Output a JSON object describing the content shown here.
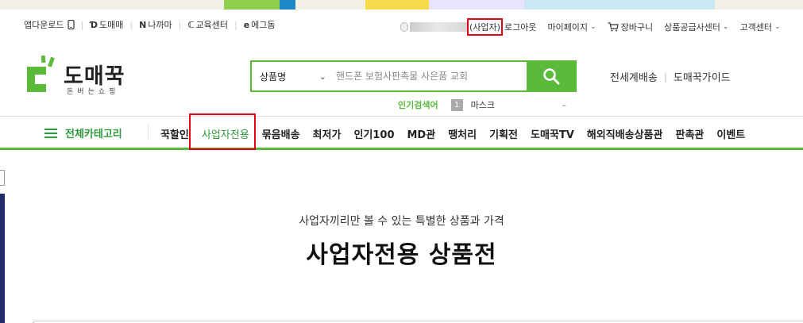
{
  "utility_bar": {
    "left_links": [
      {
        "label": "앱다운로드",
        "icon": "phone-icon"
      },
      {
        "label": "도매매",
        "icon": "domeme-logo-icon"
      },
      {
        "label": "나까마",
        "icon": "nakkama-logo-icon"
      },
      {
        "label": "교육센터",
        "icon": "edu-center-logo-icon"
      },
      {
        "label": "에그돔",
        "icon": "eggdome-logo-icon"
      }
    ],
    "user_grade": "(사업자)",
    "logout": "로그아웃",
    "mypage": "마이페이지",
    "cart": "장바구니",
    "supplier_center": "상품공급사센터",
    "customer_center": "고객센터"
  },
  "header": {
    "logo_text": "도매꾹",
    "logo_sub": "돈버는쇼핑",
    "search": {
      "category_selected": "상품명",
      "placeholder": "핸드폰 보험사판촉물 사은품 교회"
    },
    "links": [
      "전세계배송",
      "도매꾹가이드"
    ],
    "popular": {
      "label": "인기검색어",
      "rank": "1",
      "keyword": "마스크",
      "change": "–"
    }
  },
  "nav": {
    "all_category": "전체카테고리",
    "items": [
      "꾹할인",
      "사업자전용",
      "묶음배송",
      "최저가",
      "인기100",
      "MD관",
      "땡처리",
      "기획전",
      "도매꾹TV",
      "해외직배송상품관",
      "판촉관",
      "이벤트"
    ],
    "active_index": 1
  },
  "main": {
    "subtitle": "사업자끼리만 볼 수 있는 특별한 상품과 가격",
    "title": "사업자전용 상품전"
  },
  "colors": {
    "brand_green": "#5aba3a",
    "nav_active_green": "#2e9a3a",
    "highlight_red": "#e60012",
    "edge_navy": "#1f2b6b"
  }
}
